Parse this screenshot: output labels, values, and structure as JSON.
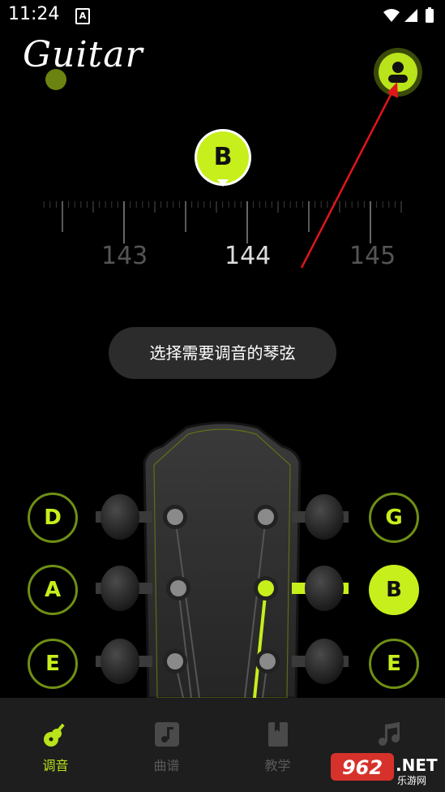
{
  "status_bar": {
    "time": "11:24",
    "notif_icon": "A"
  },
  "header": {
    "logo_text": "Guitar",
    "profile_icon": "user-icon"
  },
  "tuner": {
    "current_note": "B",
    "scale_labels": [
      "143",
      "144",
      "145"
    ]
  },
  "hint": "选择需要调音的琴弦",
  "strings": {
    "left": [
      "D",
      "A",
      "E"
    ],
    "right": [
      "G",
      "B",
      "E"
    ],
    "active": "B"
  },
  "tabs": [
    {
      "label": "调音",
      "icon": "guitar-icon",
      "active": true
    },
    {
      "label": "曲谱",
      "icon": "music-note-icon",
      "active": false
    },
    {
      "label": "教学",
      "icon": "book-icon",
      "active": false
    },
    {
      "label": "",
      "icon": "music-notes-icon",
      "active": false
    }
  ],
  "watermark": {
    "brand": "962.NET",
    "sub": "乐游网"
  },
  "colors": {
    "accent": "#c6ef1c",
    "background": "#000000",
    "tabbar": "#1e1e1e",
    "annotation_arrow": "#e0161b"
  }
}
